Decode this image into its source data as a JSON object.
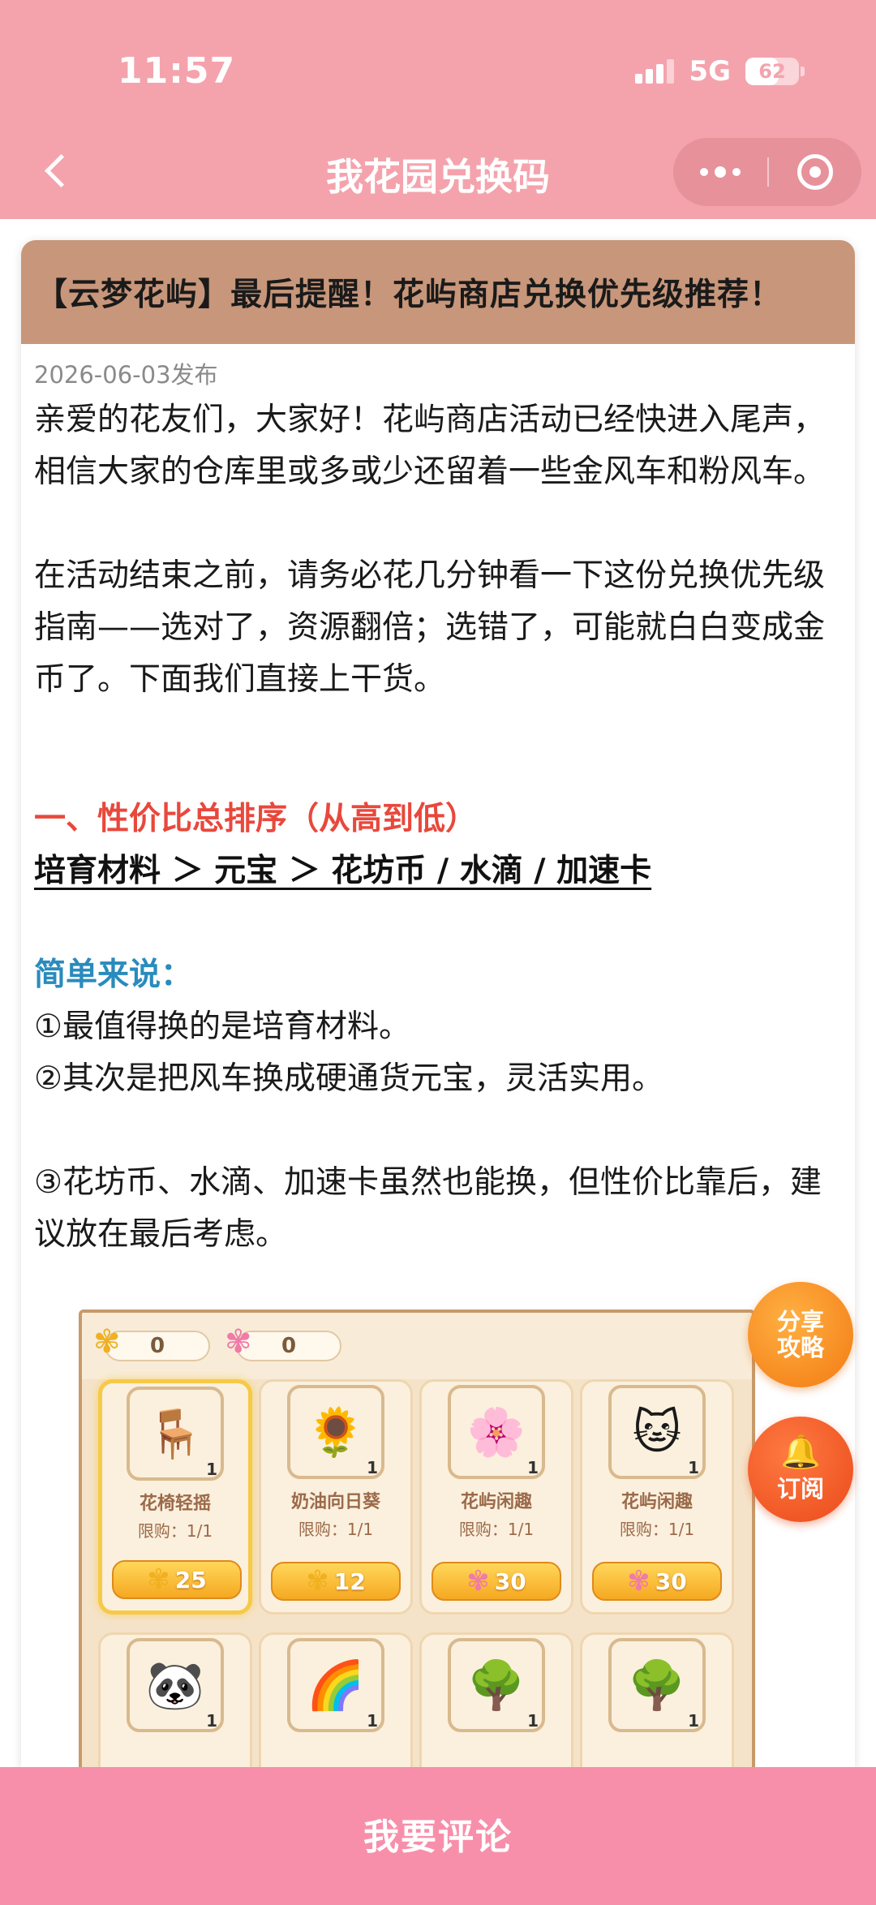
{
  "status_bar": {
    "time": "11:57",
    "network": "5G",
    "battery": "62",
    "battery_level_percent": 62
  },
  "nav": {
    "title": "我花园兑换码"
  },
  "article": {
    "title": "【云梦花屿】最后提醒！花屿商店兑换优先级推荐！",
    "date": "2026-06-03发布",
    "para1": "亲爱的花友们，大家好！花屿商店活动已经快进入尾声，相信大家的仓库里或多或少还留着一些金风车和粉风车。",
    "para2": "在活动结束之前，请务必花几分钟看一下这份兑换优先级指南——选对了，资源翻倍；选错了，可能就白白变成金币了。下面我们直接上干货。",
    "section1_heading": "一、性价比总排序（从高到低）",
    "ranking": "培育材料 ＞ 元宝 ＞ 花坊币 / 水滴 / 加速卡",
    "simple_heading": "简单来说：",
    "point1": "①最值得换的是培育材料。",
    "point2": "②其次是把风车换成硬通货元宝，灵活实用。",
    "point3": "③花坊币、水滴、加速卡虽然也能换，但性价比靠后，建议放在最后考虑。"
  },
  "game_image": {
    "gold_count": "0",
    "pink_count": "0",
    "row1": [
      {
        "name": "花椅轻摇",
        "limit": "限购：1/1",
        "price": "25",
        "currency": "gold",
        "count": "1",
        "emoji": "🪑"
      },
      {
        "name": "奶油向日葵",
        "limit": "限购：1/1",
        "price": "12",
        "currency": "gold",
        "count": "1",
        "emoji": "🌻"
      },
      {
        "name": "花屿闲趣",
        "limit": "限购：1/1",
        "price": "30",
        "currency": "pink",
        "count": "1",
        "emoji": "🌸"
      },
      {
        "name": "花屿闲趣",
        "limit": "限购：1/1",
        "price": "30",
        "currency": "pink",
        "count": "1",
        "emoji": "🐱"
      }
    ],
    "row2": [
      {
        "count": "1",
        "emoji": "🐼"
      },
      {
        "count": "1",
        "emoji": "🌈"
      },
      {
        "count": "1",
        "emoji": "🌳"
      },
      {
        "count": "1",
        "emoji": "🌳"
      }
    ]
  },
  "floating": {
    "share_line1": "分享",
    "share_line2": "攻略",
    "subscribe_label": "订阅"
  },
  "bottom": {
    "comment_label": "我要评论"
  },
  "colors": {
    "header_pink": "#f4a3ad",
    "bottom_pink": "#f78fab",
    "title_bar_tan": "#c8967a",
    "heading_red": "#e8483c",
    "heading_blue": "#2a8bbd"
  },
  "icons": [
    "back-icon",
    "more-icon",
    "close-capsule-icon",
    "pinwheel-icon",
    "bell-icon"
  ]
}
